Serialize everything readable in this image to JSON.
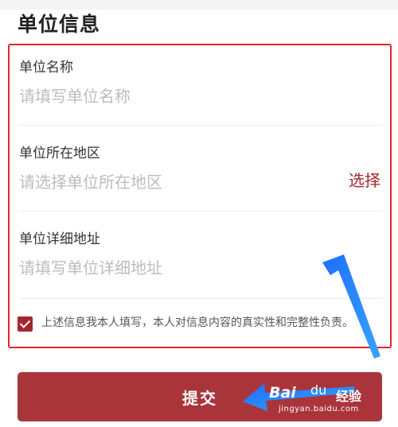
{
  "section": {
    "title": "单位信息"
  },
  "form": {
    "fields": [
      {
        "label": "单位名称",
        "placeholder": "请填写单位名称"
      },
      {
        "label": "单位所在地区",
        "placeholder": "请选择单位所在地区",
        "action": "选择"
      },
      {
        "label": "单位详细地址",
        "placeholder": "请填写单位详细地址"
      }
    ],
    "agreement": {
      "checked": true,
      "text": "上述信息我本人填写，本人对信息内容的真实性和完整性负责。"
    }
  },
  "submit": {
    "label": "提交"
  },
  "watermark": {
    "logo": "Bai",
    "paw": "du",
    "cn": "经验",
    "url": "jingyan.baidu.com"
  },
  "colors": {
    "accent": "#a3272c",
    "highlight": "#e8212b",
    "annotation_arrow": "#1e88ff"
  }
}
